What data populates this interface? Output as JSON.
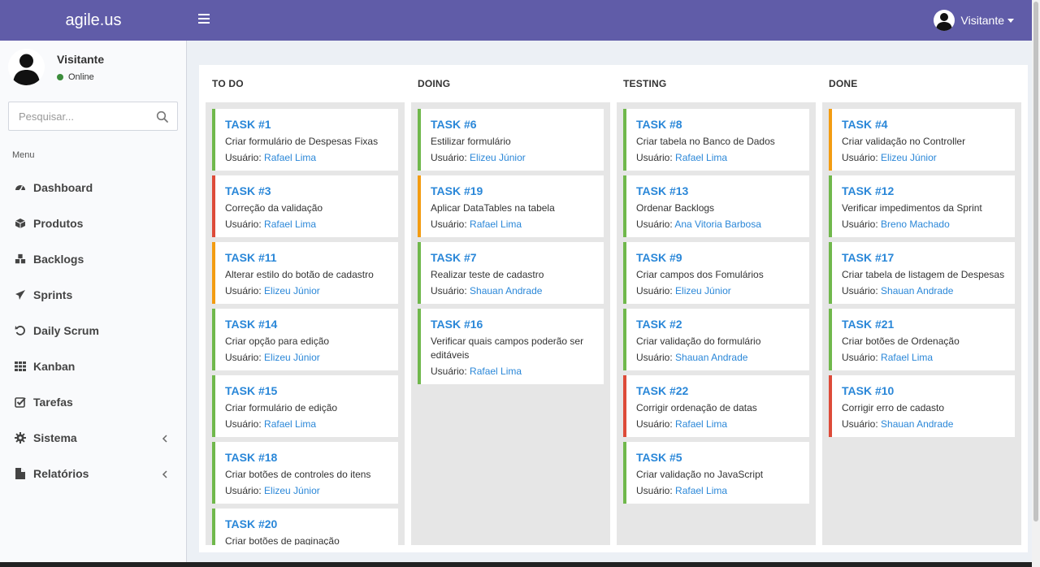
{
  "header": {
    "logo": "agile.us",
    "user_name": "Visitante"
  },
  "sidebar": {
    "user_name": "Visitante",
    "status": "Online",
    "search_placeholder": "Pesquisar...",
    "menu_header": "Menu",
    "items": [
      {
        "label": "Dashboard",
        "icon": "dashboard-icon"
      },
      {
        "label": "Produtos",
        "icon": "cube-icon"
      },
      {
        "label": "Backlogs",
        "icon": "cubes-icon"
      },
      {
        "label": "Sprints",
        "icon": "paper-plane-icon"
      },
      {
        "label": "Daily Scrum",
        "icon": "undo-icon"
      },
      {
        "label": "Kanban",
        "icon": "grid-icon"
      },
      {
        "label": "Tarefas",
        "icon": "checkbox-icon"
      },
      {
        "label": "Sistema",
        "icon": "gear-icon"
      },
      {
        "label": "Relatórios",
        "icon": "file-icon"
      }
    ]
  },
  "board": {
    "user_prefix": "Usuário:",
    "columns": [
      {
        "title": "TO DO",
        "cards": [
          {
            "name": "TASK #1",
            "desc": "Criar formulário de Despesas Fixas",
            "user": "Rafael Lima",
            "color": "#70b84c"
          },
          {
            "name": "TASK #3",
            "desc": "Correção da validação",
            "user": "Rafael Lima",
            "color": "#dd4b39"
          },
          {
            "name": "TASK #11",
            "desc": "Alterar estilo do botão de cadastro",
            "user": "Elizeu Júnior",
            "color": "#f39c12"
          },
          {
            "name": "TASK #14",
            "desc": "Criar opção para edição",
            "user": "Elizeu Júnior",
            "color": "#70b84c"
          },
          {
            "name": "TASK #15",
            "desc": "Criar formulário de edição",
            "user": "Rafael Lima",
            "color": "#70b84c"
          },
          {
            "name": "TASK #18",
            "desc": "Criar botões de controles do itens",
            "user": "Elizeu Júnior",
            "color": "#70b84c"
          },
          {
            "name": "TASK #20",
            "desc": "Criar botões de paginação",
            "user": "",
            "color": "#70b84c"
          }
        ]
      },
      {
        "title": "DOING",
        "cards": [
          {
            "name": "TASK #6",
            "desc": "Estilizar formulário",
            "user": "Elizeu Júnior",
            "color": "#70b84c"
          },
          {
            "name": "TASK #19",
            "desc": "Aplicar DataTables na tabela",
            "user": "Rafael Lima",
            "color": "#f39c12"
          },
          {
            "name": "TASK #7",
            "desc": "Realizar teste de cadastro",
            "user": "Shauan Andrade",
            "color": "#70b84c"
          },
          {
            "name": "TASK #16",
            "desc": "Verificar quais campos poderão ser editáveis",
            "user": "Rafael Lima",
            "color": "#70b84c"
          }
        ]
      },
      {
        "title": "TESTING",
        "cards": [
          {
            "name": "TASK #8",
            "desc": "Criar tabela no Banco de Dados",
            "user": "Rafael Lima",
            "color": "#70b84c"
          },
          {
            "name": "TASK #13",
            "desc": "Ordenar Backlogs",
            "user": "Ana Vitoria Barbosa",
            "color": "#70b84c"
          },
          {
            "name": "TASK #9",
            "desc": "Criar campos dos Fomulários",
            "user": "Elizeu Júnior",
            "color": "#70b84c"
          },
          {
            "name": "TASK #2",
            "desc": "Criar validação do formulário",
            "user": "Shauan Andrade",
            "color": "#70b84c"
          },
          {
            "name": "TASK #22",
            "desc": "Corrigir ordenação de datas",
            "user": "Rafael Lima",
            "color": "#dd4b39"
          },
          {
            "name": "TASK #5",
            "desc": "Criar validação no JavaScript",
            "user": "Rafael Lima",
            "color": "#70b84c"
          }
        ]
      },
      {
        "title": "DONE",
        "cards": [
          {
            "name": "TASK #4",
            "desc": "Criar validação no Controller",
            "user": "Elizeu Júnior",
            "color": "#f39c12"
          },
          {
            "name": "TASK #12",
            "desc": "Verificar impedimentos da Sprint",
            "user": "Breno Machado",
            "color": "#70b84c"
          },
          {
            "name": "TASK #17",
            "desc": "Criar tabela de listagem de Despesas",
            "user": "Shauan Andrade",
            "color": "#70b84c"
          },
          {
            "name": "TASK #21",
            "desc": "Criar botões de Ordenação",
            "user": "Rafael Lima",
            "color": "#70b84c"
          },
          {
            "name": "TASK #10",
            "desc": "Corrigir erro de cadasto",
            "user": "Shauan Andrade",
            "color": "#dd4b39"
          }
        ]
      }
    ]
  }
}
